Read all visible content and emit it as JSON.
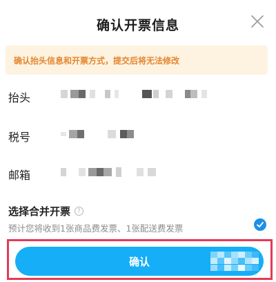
{
  "dialog": {
    "title": "确认开票信息",
    "notice": "确认抬头信息和开票方式，提交后将无法修改"
  },
  "fields": [
    {
      "label": "抬头",
      "value_visible": false
    },
    {
      "label": "税号",
      "value_visible": false
    },
    {
      "label": "邮箱",
      "value_visible": false
    }
  ],
  "merge": {
    "title": "选择合并开票",
    "help_icon_glyph": "?",
    "description": "预计您将收到1张商品费发票、1张配送费发票",
    "checked": true
  },
  "actions": {
    "confirm_label": "确认"
  },
  "colors": {
    "notice_bg": "#fdf3e0",
    "notice_text": "#e5862f",
    "primary": "#15aef7",
    "checkbox": "#1e90e6",
    "highlight_border": "#e23b55"
  }
}
